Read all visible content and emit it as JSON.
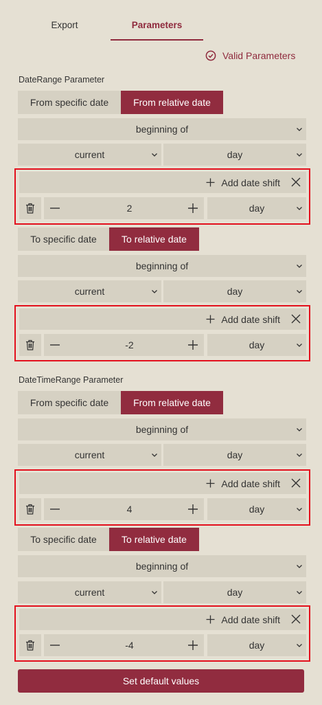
{
  "tabs": [
    {
      "label": "Export",
      "active": false
    },
    {
      "label": "Parameters",
      "active": true
    }
  ],
  "status": {
    "label": "Valid Parameters",
    "icon": "check-circle-icon",
    "color": "#8f2a3d"
  },
  "colors": {
    "accent": "#912c3f",
    "control_bg": "#d6d1c3",
    "page_bg": "#e5e0d3",
    "highlight_border": "#e3101d"
  },
  "params": [
    {
      "title": "DateRange Parameter",
      "from": {
        "mode_options": [
          "From specific date",
          "From relative date"
        ],
        "active_mode": 1,
        "anchor": "beginning of",
        "period_mod": "current",
        "period": "day",
        "shift": {
          "add_label": "Add date shift",
          "value": "2",
          "unit": "day"
        }
      },
      "to": {
        "mode_options": [
          "To specific date",
          "To relative date"
        ],
        "active_mode": 1,
        "anchor": "beginning of",
        "period_mod": "current",
        "period": "day",
        "shift": {
          "add_label": "Add date shift",
          "value": "-2",
          "unit": "day"
        }
      }
    },
    {
      "title": "DateTimeRange Parameter",
      "from": {
        "mode_options": [
          "From specific date",
          "From relative date"
        ],
        "active_mode": 1,
        "anchor": "beginning of",
        "period_mod": "current",
        "period": "day",
        "shift": {
          "add_label": "Add date shift",
          "value": "4",
          "unit": "day"
        }
      },
      "to": {
        "mode_options": [
          "To specific date",
          "To relative date"
        ],
        "active_mode": 1,
        "anchor": "beginning of",
        "period_mod": "current",
        "period": "day",
        "shift": {
          "add_label": "Add date shift",
          "value": "-4",
          "unit": "day"
        }
      }
    }
  ],
  "footer": {
    "default_label": "Set default values"
  }
}
